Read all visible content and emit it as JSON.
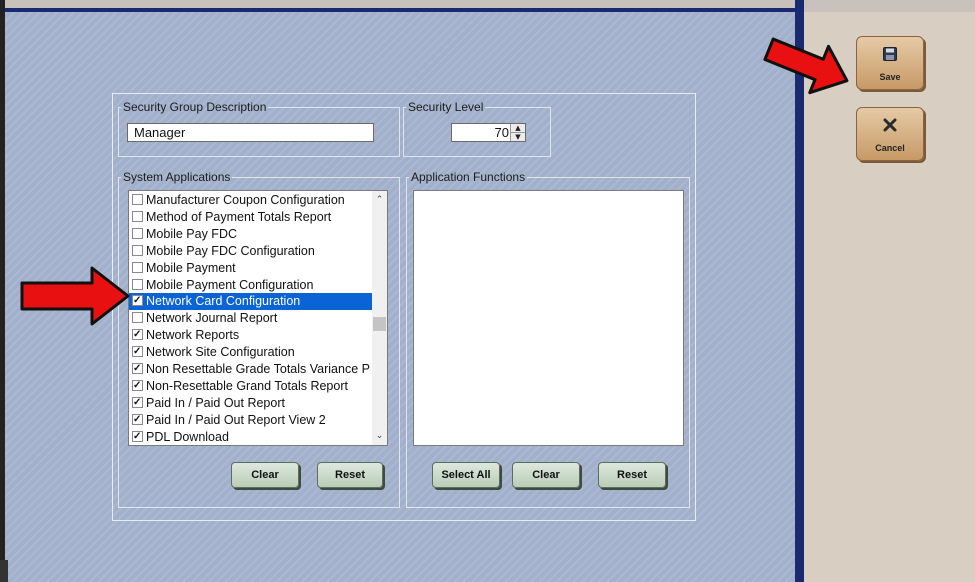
{
  "security_group": {
    "legend": "Security Group Description",
    "value": "Manager"
  },
  "security_level": {
    "legend": "Security Level",
    "value": "70"
  },
  "system_applications": {
    "legend": "System Applications",
    "items": [
      {
        "label": "Manufacturer Coupon Configuration",
        "checked": false,
        "selected": false
      },
      {
        "label": "Method of Payment Totals Report",
        "checked": false,
        "selected": false
      },
      {
        "label": "Mobile Pay FDC",
        "checked": false,
        "selected": false
      },
      {
        "label": "Mobile Pay FDC Configuration",
        "checked": false,
        "selected": false
      },
      {
        "label": "Mobile Payment",
        "checked": false,
        "selected": false
      },
      {
        "label": "Mobile Payment Configuration",
        "checked": false,
        "selected": false
      },
      {
        "label": "Network Card Configuration",
        "checked": true,
        "selected": true
      },
      {
        "label": "Network Journal Report",
        "checked": false,
        "selected": false
      },
      {
        "label": "Network Reports",
        "checked": true,
        "selected": false
      },
      {
        "label": "Network Site Configuration",
        "checked": true,
        "selected": false
      },
      {
        "label": "Non Resettable Grade Totals Variance P",
        "checked": true,
        "selected": false
      },
      {
        "label": "Non-Resettable Grand Totals Report",
        "checked": true,
        "selected": false
      },
      {
        "label": "Paid In / Paid Out Report",
        "checked": true,
        "selected": false
      },
      {
        "label": "Paid In / Paid Out Report View 2",
        "checked": true,
        "selected": false
      },
      {
        "label": "PDL Download",
        "checked": true,
        "selected": false
      }
    ],
    "clear_label": "Clear",
    "reset_label": "Reset"
  },
  "application_functions": {
    "legend": "Application Functions",
    "select_all_label": "Select All",
    "clear_label": "Clear",
    "reset_label": "Reset"
  },
  "side": {
    "save_label": "Save",
    "cancel_label": "Cancel"
  },
  "colors": {
    "background": "#a6b4cf",
    "selection": "#0a64d6",
    "annotation_arrow": "#e81010"
  },
  "icons": [
    "floppy-disk-icon",
    "close-x-icon"
  ]
}
